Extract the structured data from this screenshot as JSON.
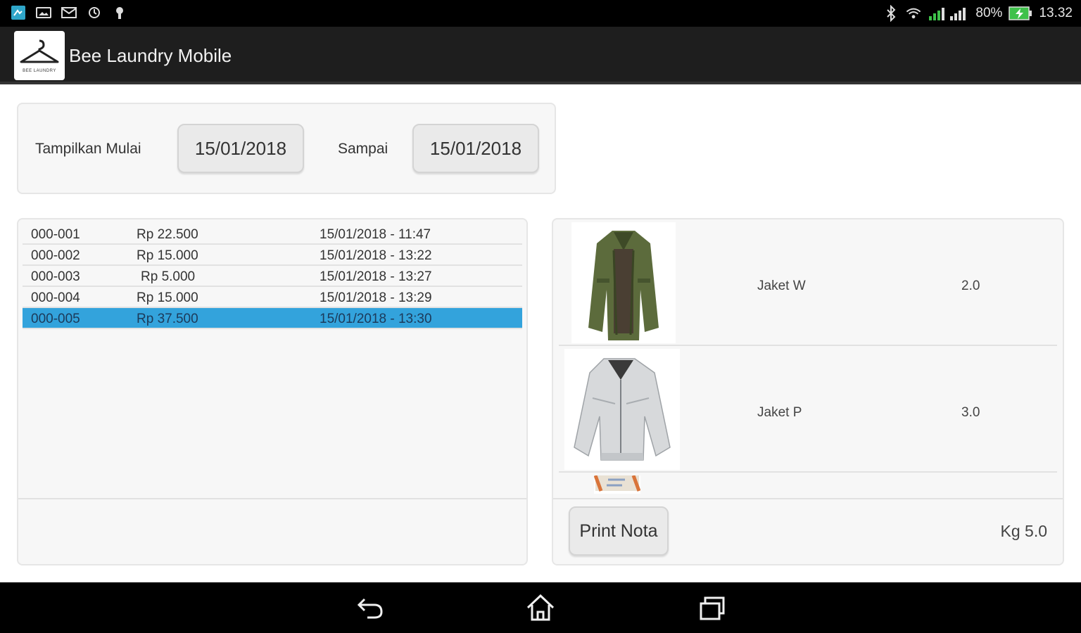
{
  "status_bar": {
    "left_icons": [
      "app-notification-icon",
      "photo-icon",
      "mail-icon",
      "sync-icon",
      "usb-icon"
    ],
    "right_icons": [
      "bluetooth-icon",
      "wifi-icon",
      "signal-icon",
      "battery-charging-icon"
    ],
    "battery": "80%",
    "time": "13.32"
  },
  "app": {
    "title": "Bee Laundry Mobile",
    "logo_icon": "hanger-icon",
    "logo_caption": "BEE LAUNDRY"
  },
  "filter": {
    "from_label": "Tampilkan Mulai",
    "from_date": "15/01/2018",
    "to_label": "Sampai",
    "to_date": "15/01/2018"
  },
  "transactions": [
    {
      "id": "000-001",
      "amount": "Rp 22.500",
      "datetime": "15/01/2018 - 11:47",
      "selected": false
    },
    {
      "id": "000-002",
      "amount": "Rp 15.000",
      "datetime": "15/01/2018 - 13:22",
      "selected": false
    },
    {
      "id": "000-003",
      "amount": "Rp 5.000",
      "datetime": "15/01/2018 - 13:27",
      "selected": false
    },
    {
      "id": "000-004",
      "amount": "Rp 15.000",
      "datetime": "15/01/2018 - 13:29",
      "selected": false
    },
    {
      "id": "000-005",
      "amount": "Rp 37.500",
      "datetime": "15/01/2018 - 13:30",
      "selected": true
    }
  ],
  "items": [
    {
      "name": "Jaket W",
      "qty": "2.0",
      "image": "green-jacket-image"
    },
    {
      "name": "Jaket P",
      "qty": "3.0",
      "image": "white-jacket-image"
    }
  ],
  "detail_footer": {
    "print_label": "Print Nota",
    "total_weight": "Kg 5.0"
  },
  "nav": {
    "back_icon": "back-icon",
    "home_icon": "home-icon",
    "recents_icon": "recents-icon"
  },
  "colors": {
    "selected_row": "#33a3dc",
    "action_bar": "#1e1e1e",
    "panel_bg": "#f7f7f7"
  }
}
